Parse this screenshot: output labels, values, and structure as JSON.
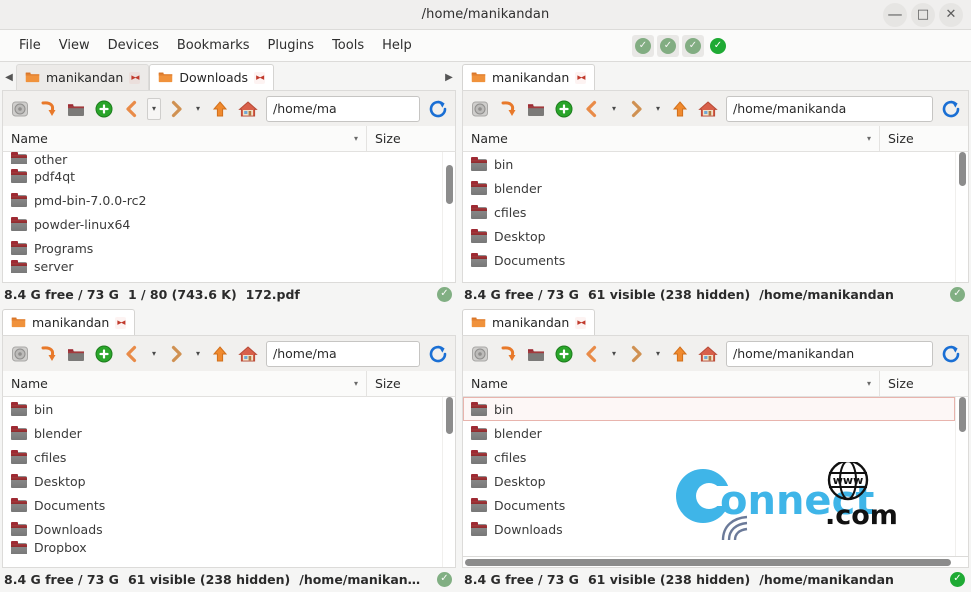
{
  "window": {
    "title": "/home/manikandan",
    "controls": [
      {
        "name": "minimize",
        "glyph": "—"
      },
      {
        "name": "maximize",
        "glyph": "□"
      },
      {
        "name": "close",
        "glyph": "✕"
      }
    ]
  },
  "menubar": {
    "items": [
      "File",
      "View",
      "Devices",
      "Bookmarks",
      "Plugins",
      "Tools",
      "Help"
    ],
    "panel_toggles": [
      {
        "name": "toggle-panel-1",
        "active": false
      },
      {
        "name": "toggle-panel-2",
        "active": false
      },
      {
        "name": "toggle-panel-3",
        "active": false
      },
      {
        "name": "toggle-panel-4",
        "active": true
      }
    ],
    "toggle_glyph": "✓"
  },
  "toolbar": {
    "icons": [
      {
        "name": "media-eject-icon",
        "title": "Open media"
      },
      {
        "name": "sync-arrow-icon",
        "title": "Equal panels"
      },
      {
        "name": "folder-icon",
        "title": "Open folder"
      },
      {
        "name": "add-tab-icon",
        "title": "New tab"
      },
      {
        "name": "back-icon",
        "title": "Back"
      },
      {
        "name": "back-history-caret",
        "title": "Back history"
      },
      {
        "name": "forward-icon",
        "title": "Forward"
      },
      {
        "name": "forward-history-caret",
        "title": "Forward history"
      },
      {
        "name": "up-icon",
        "title": "Up"
      },
      {
        "name": "home-icon",
        "title": "Home"
      }
    ],
    "refresh_icon": "refresh-icon",
    "caret_glyph": "▾"
  },
  "columns": {
    "name": "Name",
    "size": "Size",
    "sort_glyph": "▾"
  },
  "folder_name": "manikandan",
  "panels": [
    {
      "id": "top-left",
      "tabs": [
        {
          "label": "manikandan",
          "active": false
        },
        {
          "label": "Downloads",
          "active": true
        }
      ],
      "has_tab_scroll_arrows": true,
      "path_field": "/home/ma",
      "rows": [
        {
          "name": "other",
          "clipped": "top"
        },
        {
          "name": "pdf4qt"
        },
        {
          "name": "pmd-bin-7.0.0-rc2"
        },
        {
          "name": "powder-linux64"
        },
        {
          "name": "Programs"
        },
        {
          "name": "server",
          "clipped": "bottom"
        }
      ],
      "scrollbar": {
        "top_pct": 10,
        "height_pct": 30
      },
      "status": {
        "free": "8.4 G free / 73 G",
        "selection": "1 / 80 (743.6 K)",
        "path": "172.pdf",
        "active": false
      }
    },
    {
      "id": "top-right",
      "tabs": [
        {
          "label": "manikandan",
          "active": true
        }
      ],
      "has_tab_scroll_arrows": false,
      "path_field": "/home/manikanda",
      "rows": [
        {
          "name": "bin"
        },
        {
          "name": "blender"
        },
        {
          "name": "cfiles"
        },
        {
          "name": "Desktop"
        },
        {
          "name": "Documents"
        }
      ],
      "scrollbar": {
        "top_pct": 0,
        "height_pct": 26
      },
      "status": {
        "free": "8.4 G free / 73 G",
        "selection": "61 visible (238 hidden)",
        "path": "/home/manikandan",
        "active": false
      }
    },
    {
      "id": "bottom-left",
      "tabs": [
        {
          "label": "manikandan",
          "active": true
        }
      ],
      "has_tab_scroll_arrows": false,
      "path_field": "/home/ma",
      "rows": [
        {
          "name": "bin"
        },
        {
          "name": "blender"
        },
        {
          "name": "cfiles"
        },
        {
          "name": "Desktop"
        },
        {
          "name": "Documents"
        },
        {
          "name": "Downloads"
        },
        {
          "name": "Dropbox",
          "clipped": "bottom"
        }
      ],
      "scrollbar": {
        "top_pct": 0,
        "height_pct": 22
      },
      "status": {
        "free": "8.4 G free / 73 G",
        "selection": "61 visible (238 hidden)",
        "path": "/home/manikan…",
        "active": false
      }
    },
    {
      "id": "bottom-right",
      "tabs": [
        {
          "label": "manikandan",
          "active": true
        }
      ],
      "has_tab_scroll_arrows": false,
      "path_field": "/home/manikandan",
      "rows": [
        {
          "name": "bin",
          "focused": true
        },
        {
          "name": "blender"
        },
        {
          "name": "cfiles"
        },
        {
          "name": "Desktop"
        },
        {
          "name": "Documents"
        },
        {
          "name": "Downloads"
        }
      ],
      "scrollbar": {
        "top_pct": 0,
        "height_pct": 22
      },
      "hscrollbar": {
        "left_pct": 0,
        "width_pct": 97
      },
      "status": {
        "free": "8.4 G free / 73 G",
        "selection": "61 visible (238 hidden)",
        "path": "/home/manikandan",
        "active": true
      }
    }
  ],
  "watermark": {
    "text_main": "onnect",
    "text_dot": ".com",
    "globe_text": "www",
    "color": "#3fb5e8"
  },
  "colors": {
    "accent_green": "#1faa34",
    "tab_active_bg": "#ffffff",
    "panel_bg": "#ffffff",
    "chrome_bg": "#f1f0ee",
    "focus_outline": "#e8b4ad"
  }
}
